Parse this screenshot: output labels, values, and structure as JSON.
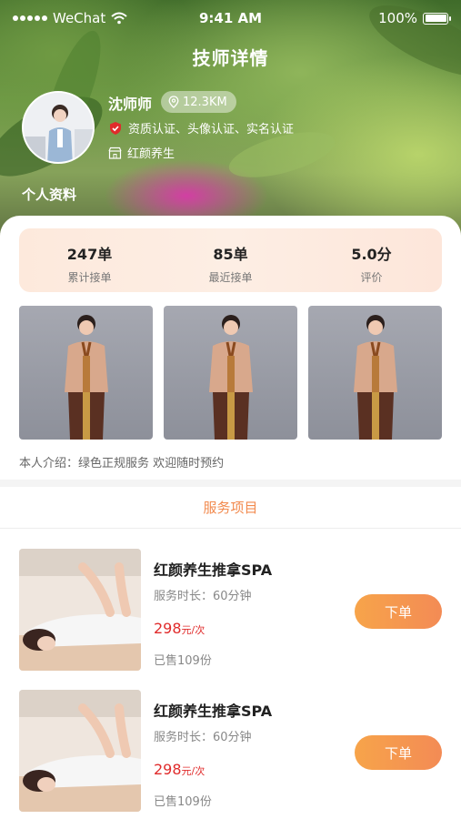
{
  "status_bar": {
    "carrier": "WeChat",
    "time": "9:41 AM",
    "battery": "100%"
  },
  "header": {
    "title": "技师详情"
  },
  "profile": {
    "name": "沈师师",
    "distance": "12.3KM",
    "certifications": "资质认证、头像认证、实名认证",
    "shop": "红颜养生",
    "section_label": "个人资料"
  },
  "stats": [
    {
      "value": "247单",
      "label": "累计接单"
    },
    {
      "value": "85单",
      "label": "最近接单"
    },
    {
      "value": "5.0分",
      "label": "评价"
    }
  ],
  "intro": "本人介绍：绿色正规服务 欢迎随时预约",
  "services_section": {
    "title": "服务项目"
  },
  "services": [
    {
      "title": "红颜养生推拿SPA",
      "duration": "服务时长：60分钟",
      "price": "298",
      "price_unit": "元/次",
      "sold": "已售109份",
      "button": "下单"
    },
    {
      "title": "红颜养生推拿SPA",
      "duration": "服务时长：60分钟",
      "price": "298",
      "price_unit": "元/次",
      "sold": "已售109份",
      "button": "下单"
    }
  ],
  "colors": {
    "accent": "#f38b55",
    "price": "#e02b2b",
    "section_title": "#f28a4e",
    "cert_badge": "#e02b2b"
  }
}
